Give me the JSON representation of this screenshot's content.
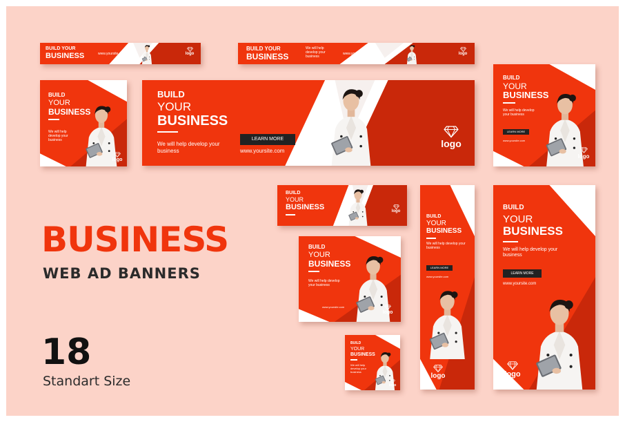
{
  "colors": {
    "background": "#fcd3c8",
    "accent": "#f0350d",
    "dark_accent": "#c9280a",
    "button": "#222222",
    "text_dark": "#2b2b2b"
  },
  "headline": "BUSINESS",
  "subheadline": "WEB AD BANNERS",
  "count": "18",
  "count_label": "Standart Size",
  "banner_text": {
    "build": "BUILD",
    "your": "YOUR",
    "business": "BUSINESS",
    "build_your": "BUILD YOUR",
    "description": "We will help develop your business",
    "button": "LEARN MORE",
    "url": "www.yoursite.com",
    "logo": "logo"
  },
  "icons": {
    "logo": "diamond-icon",
    "model": "woman-with-tablet-photo"
  }
}
